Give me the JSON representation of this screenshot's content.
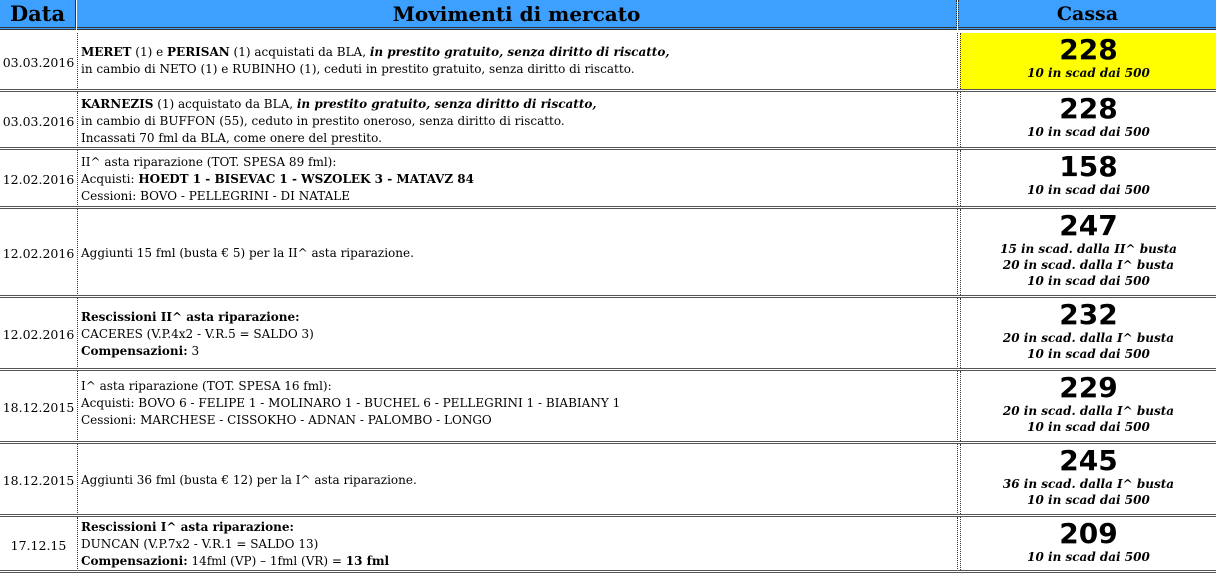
{
  "header": {
    "date": "Data",
    "movements": "Movimenti di mercato",
    "cash": "Cassa"
  },
  "rows": [
    {
      "date": "03.03.2016",
      "l1a": "MERET",
      "l1b": " (1) e ",
      "l1c": "PERISAN",
      "l1d": " (1) acquistati da BLA,  ",
      "l1e": "in prestito gratuito, senza diritto di riscatto,",
      "l2": "in cambio di NETO (1) e RUBINHO (1), ceduti in prestito gratuito, senza diritto di riscatto.",
      "cash": "228",
      "notes": [
        "10 in scad dai 500"
      ]
    },
    {
      "date": "03.03.2016",
      "l1a": "KARNEZIS",
      "l1b": " (1) acquistato da BLA,  ",
      "l1c": "in prestito gratuito, senza diritto di riscatto,",
      "l2": "in cambio di BUFFON (55), ceduto in prestito oneroso, senza diritto di riscatto.",
      "l3": "Incassati 70 fml da BLA, come onere del prestito.",
      "cash": "228",
      "notes": [
        "10 in scad dai 500"
      ]
    },
    {
      "date": "12.02.2016",
      "l1": "II^ asta riparazione (TOT. SPESA 89 fml):",
      "l2a": "Acquisti: ",
      "l2b": "HOEDT 1 - BISEVAC 1 - WSZOLEK 3 - MATAVZ 84",
      "l3": "Cessioni: BOVO - PELLEGRINI - DI NATALE",
      "cash": "158",
      "notes": [
        "10 in scad dai 500"
      ]
    },
    {
      "date": "12.02.2016",
      "l1": "Aggiunti 15 fml (busta € 5) per la II^ asta riparazione.",
      "cash": "247",
      "notes": [
        "15 in scad. dalla II^ busta",
        "20 in scad. dalla I^ busta",
        "10 in scad dai 500"
      ]
    },
    {
      "date": "12.02.2016",
      "l1": "Rescissioni II^ asta riparazione:",
      "l2": "CACERES (V.P.4x2 - V.R.5 = SALDO 3)",
      "l3a": "Compensazioni:",
      "l3b": " 3",
      "cash": "232",
      "notes": [
        "20 in scad. dalla I^ busta",
        "10 in scad dai 500"
      ]
    },
    {
      "date": "18.12.2015",
      "l1": "I^ asta riparazione (TOT. SPESA 16 fml):",
      "l2": "Acquisti: BOVO 6 - FELIPE 1 - MOLINARO 1 - BUCHEL 6 - PELLEGRINI 1 - BIABIANY 1",
      "l3": "Cessioni: MARCHESE - CISSOKHO - ADNAN - PALOMBO - LONGO",
      "cash": "229",
      "notes": [
        "20 in scad. dalla I^ busta",
        "10 in scad dai 500"
      ]
    },
    {
      "date": "18.12.2015",
      "l1": "Aggiunti 36 fml (busta € 12) per la I^ asta riparazione.",
      "cash": "245",
      "notes": [
        "36 in scad. dalla I^ busta",
        "10 in scad dai 500"
      ]
    },
    {
      "date": "17.12.15",
      "l1": "Rescissioni I^ asta riparazione:",
      "l2": "DUNCAN (V.P.7x2 - V.R.1 = SALDO 13)",
      "l3a": "Compensazioni:",
      "l3b": " 14fml (VP) – 1fml (VR) = ",
      "l3c": "13 fml",
      "cash": "209",
      "notes": [
        "10 in scad dai 500"
      ]
    }
  ],
  "colors": {
    "header_bg": "#3da0ff",
    "highlight": "#ffff00"
  }
}
